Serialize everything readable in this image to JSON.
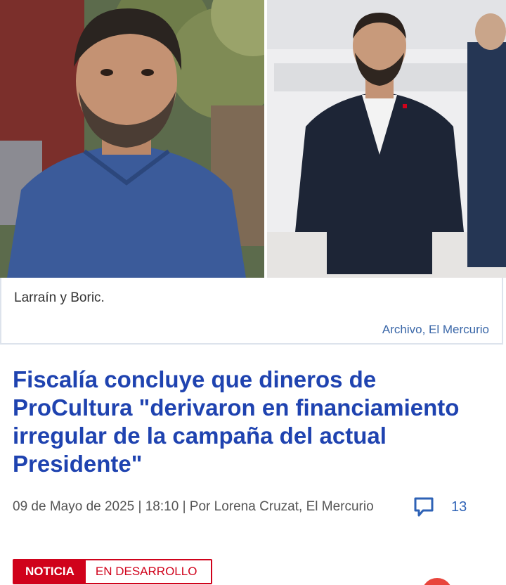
{
  "photo": {
    "caption": "Larraín y Boric.",
    "credit": "Archivo, El Mercurio"
  },
  "article": {
    "headline": "Fiscalía concluye que dineros de ProCultura \"derivaron en financiamiento irregular de la campaña del actual Presidente\"",
    "meta": "09 de Mayo de 2025 | 18:10 | Por Lorena Cruzat, El Mercurio",
    "comment_count": "13"
  },
  "badge": {
    "primary": "NOTICIA",
    "secondary": "EN DESARROLLO"
  },
  "colors": {
    "headline": "#1f43b0",
    "credit": "#3a67a8",
    "badge_red": "#d0021b",
    "comment_blue": "#2e62b6"
  },
  "icons": {
    "comments": "speech-bubble-icon"
  }
}
